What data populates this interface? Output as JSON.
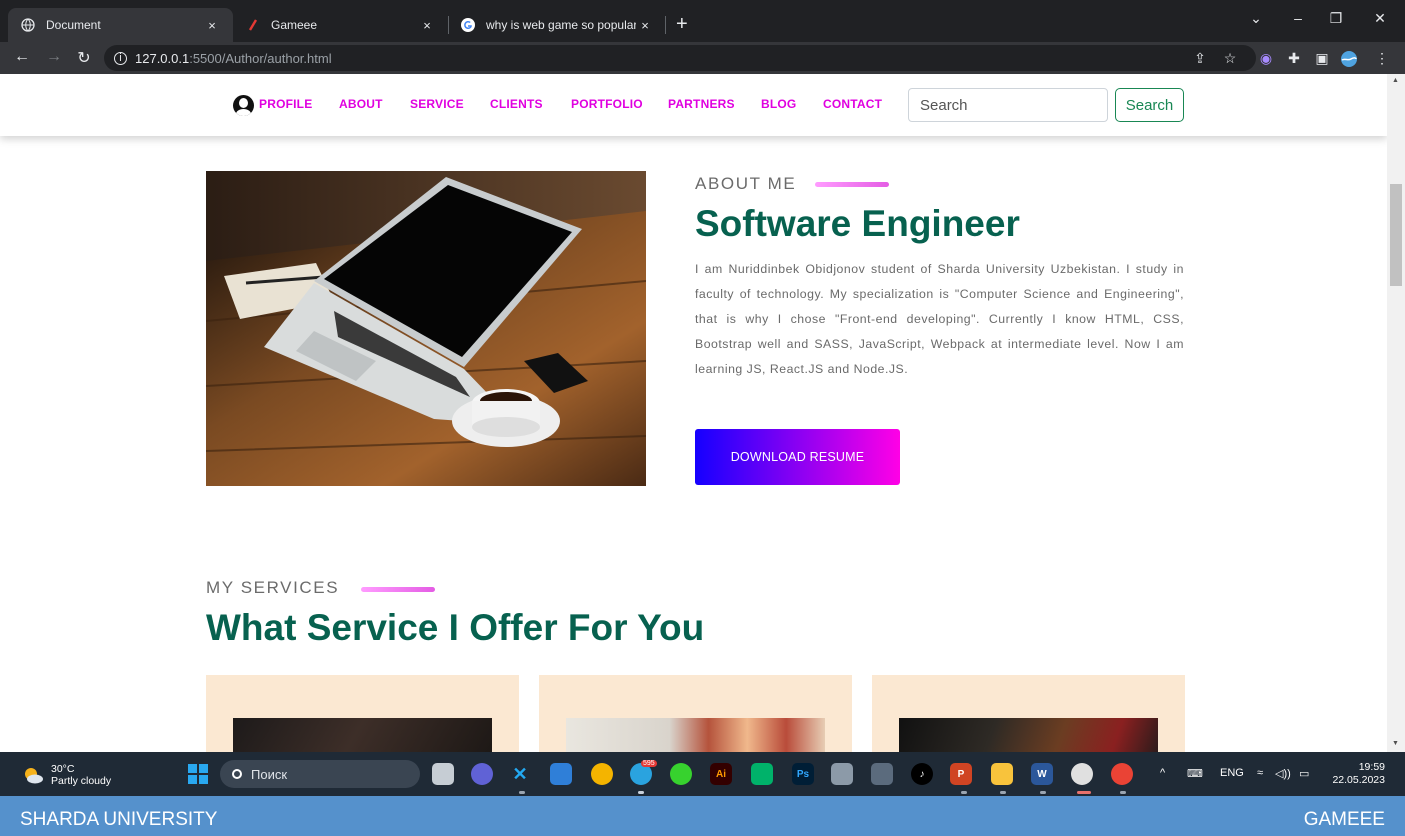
{
  "browser": {
    "tabs": [
      {
        "title": "Document",
        "active": true
      },
      {
        "title": "Gameee",
        "active": false
      },
      {
        "title": "why is web game so popular now",
        "active": false
      }
    ],
    "close_glyph": "×",
    "new_tab_glyph": "+",
    "url_host": "127.0.0.1",
    "url_path": ":5500/Author/author.html"
  },
  "site": {
    "nav": [
      "PROFILE",
      "ABOUT",
      "SERVICE",
      "CLIENTS",
      "PORTFOLIO",
      "PARTNERS",
      "BLOG",
      "CONTACT"
    ],
    "search_placeholder": "Search",
    "search_button": "Search",
    "about": {
      "eyebrow": "ABOUT ME",
      "title": "Software Engineer",
      "paragraph": "I am Nuriddinbek Obidjonov student of Sharda University Uzbekistan. I study in faculty of technology. My specialization is \"Computer Science and Engineering\", that is why I chose \"Front-end developing\". Currently I know HTML, CSS, Bootstrap well and SASS, JavaScript, Webpack at intermediate level. Now I am learning JS, React.JS and Node.JS.",
      "button": "DOWNLOAD RESUME"
    },
    "services": {
      "eyebrow": "MY SERVICES",
      "title": "What Service I Offer For You"
    }
  },
  "taskbar": {
    "temperature": "30°C",
    "weather": "Partly cloudy",
    "search": "Поиск",
    "lang": "ENG",
    "time": "19:59",
    "date": "22.05.2023",
    "badge": "595"
  },
  "strip": {
    "left": "SHARDA UNIVERSITY",
    "right": "GAMEEE"
  },
  "colors": {
    "nav_link": "#e000e0",
    "heading": "#07614f",
    "button_gradient": [
      "#1500ff",
      "#ff00e6"
    ],
    "card_bg": "#fbe8d2",
    "strip_bg": "#5591cc"
  }
}
